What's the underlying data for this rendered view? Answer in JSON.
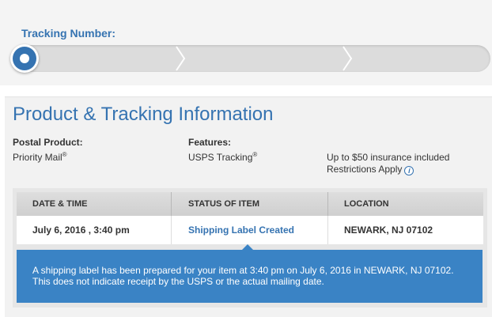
{
  "tracking": {
    "label": "Tracking Number:",
    "steps_completed": 1,
    "steps_total": 3,
    "accent_color": "#3573b1"
  },
  "product": {
    "title": "Product & Tracking Information",
    "postal_product_heading": "Postal Product:",
    "postal_product_value": "Priority Mail",
    "postal_product_mark": "®",
    "features_heading": "Features:",
    "features_value": "USPS Tracking",
    "features_mark": "®",
    "insurance_text": "Up to $50 insurance included",
    "restrictions_text": "Restrictions Apply",
    "info_icon": "info-icon"
  },
  "table": {
    "headers": [
      "DATE & TIME",
      "STATUS OF ITEM",
      "LOCATION"
    ],
    "rows": [
      {
        "date_time": "July 6, 2016 , 3:40 pm",
        "status": "Shipping Label Created",
        "location": "NEWARK, NJ 07102"
      }
    ],
    "detail_text": "A shipping label has been prepared for your item at 3:40 pm on July 6, 2016 in NEWARK, NJ 07102. This does not indicate receipt by the USPS or the actual mailing date.",
    "detail_color": "#3a83c5"
  }
}
